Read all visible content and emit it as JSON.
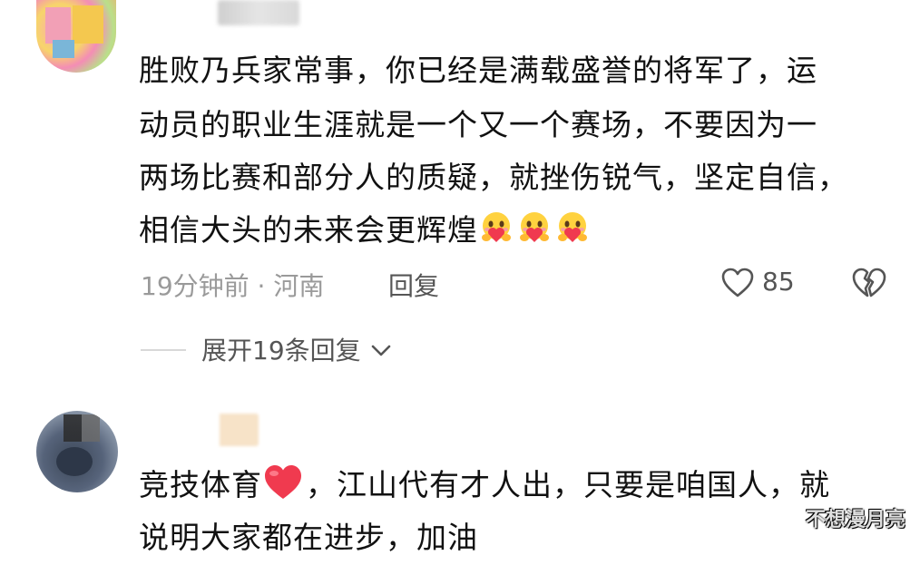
{
  "comments": [
    {
      "lines": [
        "胜败乃兵家常事，你已经是满载盛誉的将军了，运",
        "动员的职业生涯就是一个又一个赛场，不要因为一",
        "两场比赛和部分人的质疑，就挫伤锐气，坚定自信，",
        "相信大头的未来会更辉煌"
      ],
      "emojis": [
        "hug-heart-emoji",
        "hug-heart-emoji",
        "hug-heart-emoji"
      ],
      "time_location": "19分钟前 · 河南",
      "reply_label": "回复",
      "like_count": "85",
      "expand_label": "展开19条回复"
    },
    {
      "line1_a": "竞技体育",
      "line1_b": "，江山代有才人出，只要是咱国人，就",
      "line2": "说明大家都在进步，加油"
    }
  ],
  "watermark": "不想漫月亮",
  "colors": {
    "heart": "#f03a4f",
    "meta": "#9a9a9a"
  }
}
